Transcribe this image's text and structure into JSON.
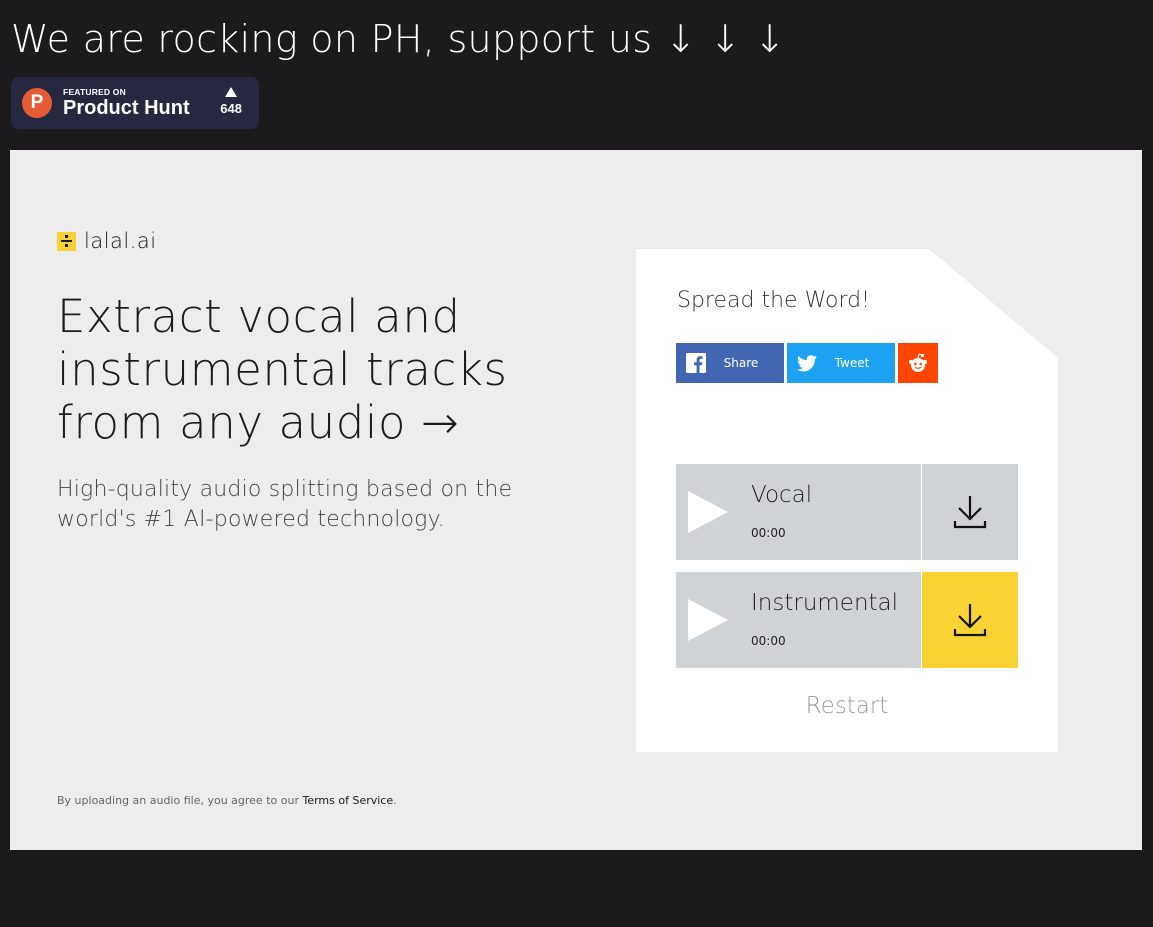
{
  "banner": {
    "text": "We are rocking on PH, support us ↓ ↓ ↓"
  },
  "product_hunt": {
    "logo_letter": "P",
    "featured_label": "FEATURED ON",
    "name": "Product Hunt",
    "votes": "648",
    "logo_color": "#e75b34"
  },
  "brand": {
    "name": "lalal.ai",
    "icon": "divide-icon",
    "accent": "#f9d333"
  },
  "hero": {
    "headline": "Extract vocal and instrumental tracks from any audio →",
    "subline": "High-quality audio splitting based on the world's #1 AI-powered technology."
  },
  "terms": {
    "prefix": "By uploading an audio file, you agree to our ",
    "link": "Terms of Service",
    "suffix": "."
  },
  "card": {
    "title": "Spread the Word!",
    "share_buttons": [
      {
        "label": "Share",
        "icon": "facebook-icon",
        "color": "#4267b2"
      },
      {
        "label": "Tweet",
        "icon": "twitter-icon",
        "color": "#1da1f2"
      },
      {
        "label": "",
        "icon": "reddit-icon",
        "color": "#ff4500"
      }
    ],
    "tracks": [
      {
        "name": "Vocal",
        "time": "00:00",
        "download_color": "#d0d3d6",
        "icon": "download-icon"
      },
      {
        "name": "Instrumental",
        "time": "00:00",
        "download_color": "#f9d333",
        "icon": "download-icon"
      }
    ],
    "restart_label": "Restart"
  }
}
